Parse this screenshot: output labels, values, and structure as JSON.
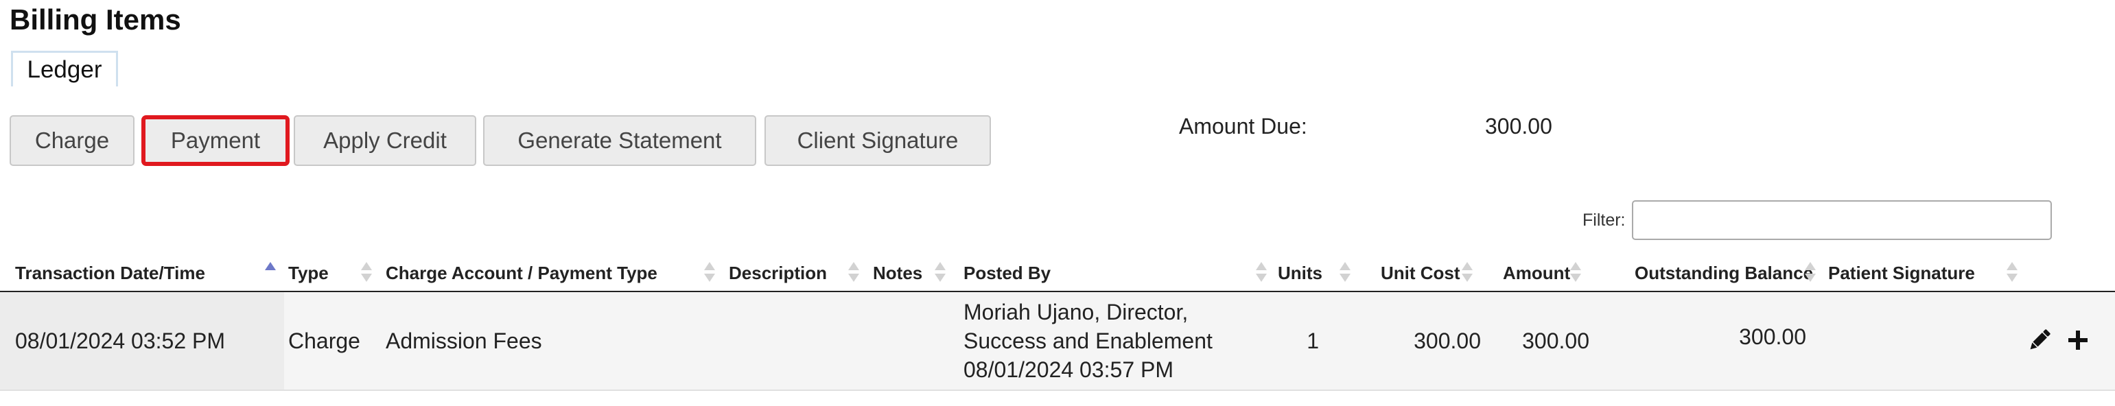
{
  "page_title": "Billing Items",
  "tabs": [
    {
      "label": "Ledger"
    }
  ],
  "toolbar": {
    "buttons": [
      {
        "label": "Charge"
      },
      {
        "label": "Payment"
      },
      {
        "label": "Apply Credit"
      },
      {
        "label": "Generate Statement"
      },
      {
        "label": "Client Signature"
      }
    ],
    "selected_label": "Payment",
    "highlight_color": "#e0191f"
  },
  "summary": {
    "amount_due_label": "Amount Due:",
    "amount_due_value": "300.00"
  },
  "filter": {
    "label": "Filter:",
    "value": ""
  },
  "table": {
    "columns": [
      "Transaction Date/Time",
      "Type",
      "Charge Account / Payment Type",
      "Description",
      "Notes",
      "Posted By",
      "Units",
      "Unit Cost",
      "Amount",
      "Outstanding Balance",
      "Patient Signature"
    ],
    "sorted_column": "Transaction Date/Time",
    "sort_direction": "ascending",
    "rows": [
      {
        "date_time": "08/01/2024 03:52 PM",
        "type": "Charge",
        "account": "Admission Fees",
        "description": "",
        "notes": "",
        "posted_by": [
          "Moriah Ujano, Director,",
          "Success and Enablement",
          "08/01/2024 03:57 PM"
        ],
        "units": "1",
        "unit_cost": "300.00",
        "amount": "300.00",
        "outstanding_balance": "300.00",
        "patient_signature": "",
        "actions": [
          "pencil-icon",
          "plus-icon"
        ]
      }
    ]
  }
}
